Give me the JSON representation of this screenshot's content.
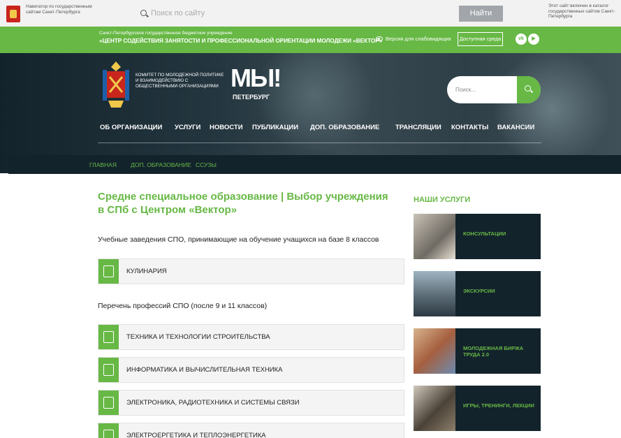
{
  "gov_bar": {
    "navigator_text": "Навигатор по государственным сайтам Санкт-Петербурга",
    "search_placeholder": "Поиск по сайту",
    "find_button": "Найти",
    "catalog_text": "Этот сайт включен в каталог государственных сайтов Санкт-Петербурга"
  },
  "org_bar": {
    "org_small": "Санкт-Петербургское государственное бюджетное учреждение",
    "org_big": "«ЦЕНТР СОДЕЙСТВИЯ ЗАНЯТОСТИ И ПРОФЕССИОНАЛЬНОЙ ОРИЕНТАЦИИ МОЛОДЕЖИ «ВЕКТОР»",
    "low_vision": "Версия для слабовидящих",
    "accessible": "Доступная среда",
    "social": [
      "vk-icon",
      "youtube-icon"
    ]
  },
  "hero": {
    "committee": "КОМИТЕТ ПО МОЛОДЕЖНОЙ ПОЛИТИКЕ И ВЗАИМОДЕЙСТВИЮ С ОБЩЕСТВЕННЫМИ ОРГАНИЗАЦИЯМИ",
    "logo_main": "МЫ!",
    "logo_sub": "ПЕТЕРБУРГ",
    "search_placeholder": "Поиск...",
    "nav": [
      "ОБ ОРГАНИЗАЦИИ",
      "УСЛУГИ",
      "НОВОСТИ",
      "ПУБЛИКАЦИИ",
      "ДОП. ОБРАЗОВАНИЕ",
      "ТРАНСЛЯЦИИ",
      "КОНТАКТЫ",
      "ВАКАНСИИ"
    ]
  },
  "breadcrumbs": [
    "ГЛАВНАЯ",
    "ДОП. ОБРАЗОВАНИЕ",
    "ССУЗЫ"
  ],
  "main": {
    "title": "Средне специальное образование | Выбор учреждения в СПб с Центром «Вектор»",
    "subhead1": "Учебные заведения СПО, принимающие на обучение учащихся на базе 8 классов",
    "group1": [
      "КУЛИНАРИЯ"
    ],
    "subhead2": "Перечень профессий СПО (после 9 и 11 классов)",
    "group2": [
      "ТЕХНИКА И ТЕХНОЛОГИИ СТРОИТЕЛЬСТВА",
      "ИНФОРМАТИКА И ВЫЧИСЛИТЕЛЬНАЯ ТЕХНИКА",
      "ЭЛЕКТРОНИКА, РАДИОТЕХНИКА И СИСТЕМЫ СВЯЗИ",
      "ЭЛЕКТРОЕРГЕТИКА И ТЕПЛОЭНЕРГЕТИКА"
    ]
  },
  "sidebar": {
    "title": "НАШИ УСЛУГИ",
    "services": [
      "КОНСУЛЬТАЦИИ",
      "ЭКСКУРСИИ",
      "МОЛОДЕЖНАЯ БИРЖА ТРУДА 2.0",
      "ИГРЫ, ТРЕНИНГИ, ЛЕКЦИИ"
    ]
  },
  "colors": {
    "accent": "#67b845",
    "dark": "#13232c"
  }
}
